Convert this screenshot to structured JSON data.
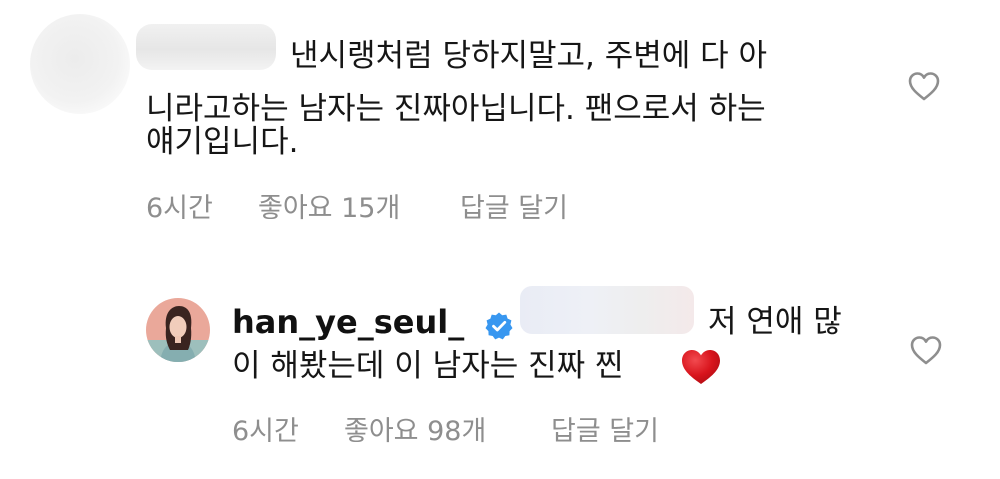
{
  "comments": [
    {
      "text_line1": "낸시랭처럼 당하지말고, 주변에 다 아",
      "text_line2": "니라고하는 남자는 진짜아닙니다. 팬으로서 하는",
      "text_line3": "얘기입니다.",
      "time": "6시간",
      "likes": "좋아요 15개",
      "reply": "답글 달기",
      "like_icon": "heart-outline-icon"
    },
    {
      "username": "han_ye_seul_",
      "verified_icon": "verified-badge-icon",
      "text_line1": "저 연애 많",
      "text_line2": "이 해봤는데 이 남자는 진짜 찐",
      "emoji": "red-heart-emoji",
      "time": "6시간",
      "likes": "좋아요 98개",
      "reply": "답글 달기",
      "like_icon": "heart-outline-icon"
    }
  ],
  "colors": {
    "text": "#161616",
    "meta": "#8e8e8e",
    "verified": "#3897f0",
    "heart_emoji": "#d8141c"
  }
}
